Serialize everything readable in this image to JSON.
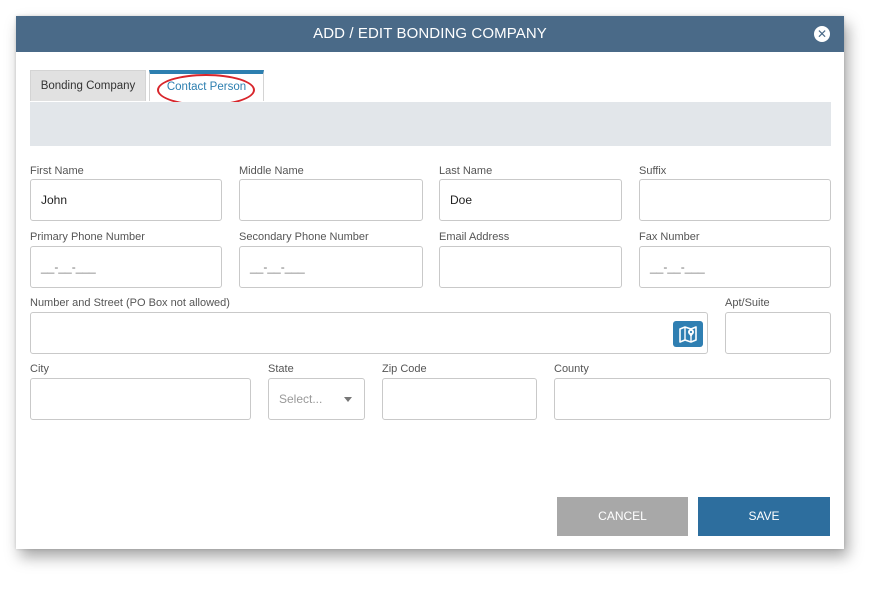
{
  "dialog": {
    "title": "ADD / EDIT BONDING COMPANY",
    "close_icon": "close-icon"
  },
  "tabs": [
    {
      "label": "Bonding Company",
      "active": false
    },
    {
      "label": "Contact Person",
      "active": true
    }
  ],
  "form": {
    "first_name": {
      "label": "First Name",
      "value": "John"
    },
    "middle_name": {
      "label": "Middle Name",
      "value": ""
    },
    "last_name": {
      "label": "Last Name",
      "value": "Doe"
    },
    "suffix": {
      "label": "Suffix",
      "value": ""
    },
    "primary_phone": {
      "label": "Primary Phone Number",
      "placeholder": "__-__-___"
    },
    "secondary_phone": {
      "label": "Secondary Phone Number",
      "placeholder": "__-__-___"
    },
    "email": {
      "label": "Email Address",
      "value": ""
    },
    "fax": {
      "label": "Fax Number",
      "placeholder": "__-__-___"
    },
    "street": {
      "label": "Number and Street (PO Box not allowed)",
      "value": "",
      "map_icon": "map-icon"
    },
    "apt": {
      "label": "Apt/Suite",
      "value": ""
    },
    "city": {
      "label": "City",
      "value": ""
    },
    "state": {
      "label": "State",
      "placeholder": "Select..."
    },
    "zip": {
      "label": "Zip Code",
      "value": ""
    },
    "county": {
      "label": "County",
      "value": ""
    }
  },
  "buttons": {
    "cancel": "CANCEL",
    "save": "SAVE"
  },
  "colors": {
    "titlebar": "#4a6a88",
    "accent": "#2d7fb0",
    "save": "#2d6e9e",
    "cancel": "#a8a8a8",
    "highlight": "#d8252b"
  }
}
